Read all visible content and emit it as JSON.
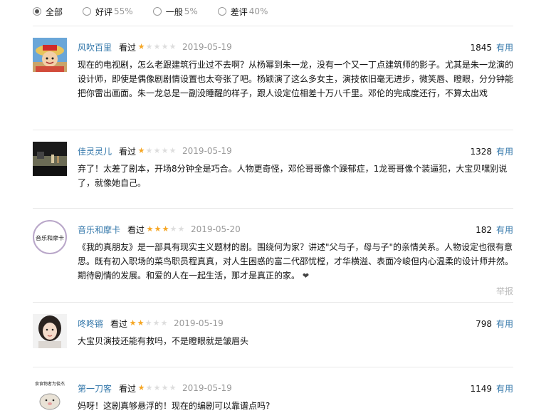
{
  "filters": [
    {
      "label": "全部",
      "pct": "",
      "checked": true
    },
    {
      "label": "好评",
      "pct": "55%",
      "checked": false
    },
    {
      "label": "一般",
      "pct": "5%",
      "checked": false
    },
    {
      "label": "差评",
      "pct": "40%",
      "checked": false
    }
  ],
  "comments": [
    {
      "user": "风吹百里",
      "status": "看过",
      "rating": 1,
      "date": "2019-05-19",
      "votes": "1845",
      "vote_label": "有用",
      "text": "现在的电视剧，怎么老跟建筑行业过不去啊？从杨幂到朱一龙，没有一个又一丁点建筑师的影子。尤其是朱一龙演的设计师，即使是偶像剧剧情设置也太夸张了吧。杨颖演了这么多女主，演技依旧毫无进步，微笑唇、瞪眼，分分钟能把你雷出画面。朱一龙总是一副没睡醒的样子，跟人设定位相差十万八千里。邓伦的完成度还行，不算太出戏"
    },
    {
      "user": "佳灵灵儿",
      "status": "看过",
      "rating": 1,
      "date": "2019-05-19",
      "votes": "1328",
      "vote_label": "有用",
      "text": "弃了！太差了剧本，开场8分钟全是巧合。人物更奇怪，邓伦哥哥像个躁郁症，1龙哥哥像个装逼犯，大宝贝嘿别说了，就像她自己。"
    },
    {
      "user": "音乐和摩卡",
      "status": "看过",
      "rating": 3,
      "date": "2019-05-20",
      "votes": "182",
      "vote_label": "有用",
      "text": "《我的真朋友》是一部具有现实主义题材的剧。围绕何为家？讲述\"父与子，母与子\"的亲情关系。人物设定也很有意思。既有初入职场的菜鸟职员程真真，对人生困惑的富二代邵忧樘，才华横溢、表面冷峻但内心温柔的设计师井然。期待剧情的发展。和爱的人在一起生活，那才是真正的家。",
      "report": "举报",
      "avatar_text": "音乐和摩卡"
    },
    {
      "user": "咚咚锵",
      "status": "看过",
      "rating": 2,
      "date": "2019-05-19",
      "votes": "798",
      "vote_label": "有用",
      "text": "大宝贝演技还能有救吗，不是瞪眼就是皱眉头"
    },
    {
      "user": "第一刀客",
      "status": "看过",
      "rating": 1,
      "date": "2019-05-19",
      "votes": "1149",
      "vote_label": "有用",
      "text": "妈呀！这剧真够悬浮的！现在的编剧可以靠谱点吗?",
      "avatar_text": "食食物者为俊杰"
    }
  ]
}
